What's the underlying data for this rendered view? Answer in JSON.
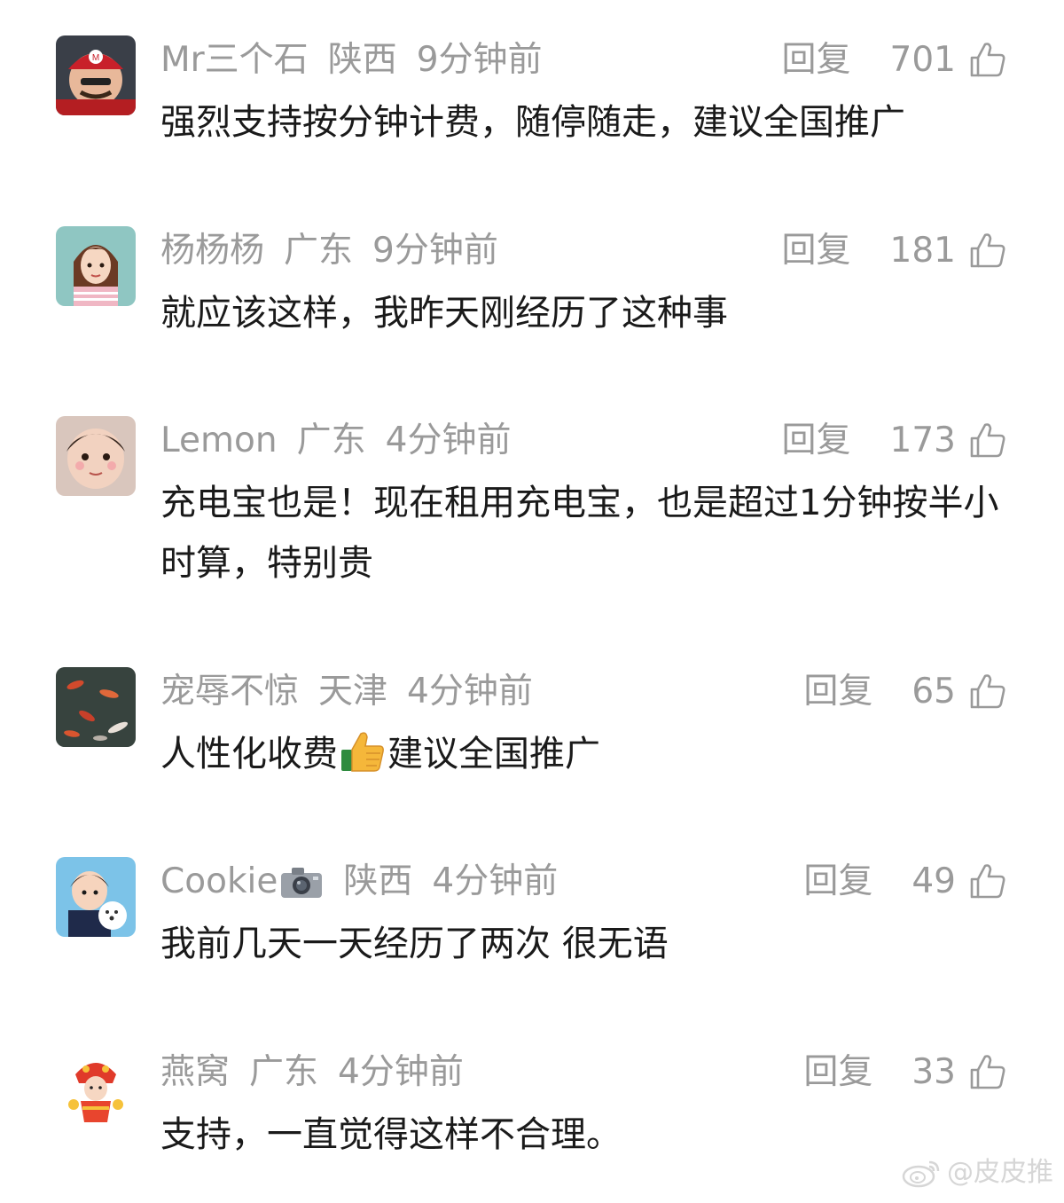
{
  "reply_label": "回复",
  "comments": [
    {
      "name": "Mr三个石",
      "region": "陕西",
      "time": "9分钟前",
      "likes": "701",
      "text": "强烈支持按分钟计费，随停随走，建议全国推广"
    },
    {
      "name": "杨杨杨",
      "region": "广东",
      "time": "9分钟前",
      "likes": "181",
      "text": "就应该这样，我昨天刚经历了这种事"
    },
    {
      "name": "Lemon",
      "region": "广东",
      "time": "4分钟前",
      "likes": "173",
      "text": "充电宝也是！现在租用充电宝，也是超过1分钟按半小时算，特别贵"
    },
    {
      "name": "宠辱不惊",
      "region": "天津",
      "time": "4分钟前",
      "likes": "65",
      "text_before": "人性化收费",
      "text_after": "建议全国推广"
    },
    {
      "name": "Cookie",
      "region": "陕西",
      "time": "4分钟前",
      "likes": "49",
      "text": "我前几天一天经历了两次 很无语"
    },
    {
      "name": "燕窝",
      "region": "广东",
      "time": "4分钟前",
      "likes": "33",
      "text": "支持，一直觉得这样不合理。"
    }
  ],
  "watermark": "@皮皮推",
  "icons": {
    "like": "thumbs-up-outline-icon",
    "emoji": "thumbs-up-emoji-icon",
    "camera": "camera-emoji-icon",
    "watermark_logo": "weibo-logo"
  },
  "colors": {
    "meta_text": "#9a9a9a",
    "body_text": "#1a1a1a",
    "watermark": "#d6d6d6"
  }
}
